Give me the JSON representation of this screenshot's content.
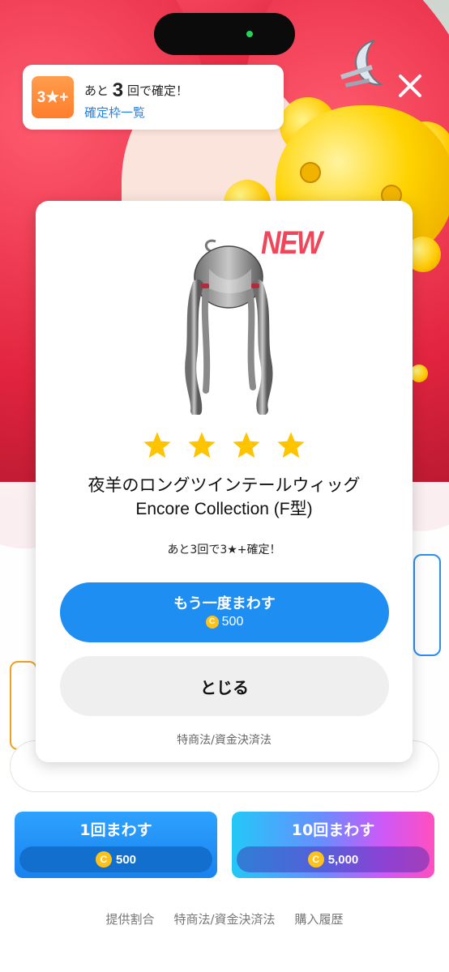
{
  "notice": {
    "badge": "3★+",
    "prefix": "あと",
    "count": "3",
    "suffix": "回で確定！",
    "link": "確定枠一覧"
  },
  "result": {
    "new_badge": "NEW",
    "rarity_stars": 4,
    "item_name_line1": "夜羊のロングツインテールウィッグ",
    "item_name_line2": "Encore Collection (F型)",
    "remaining_text": "あと3回で3★+確定！"
  },
  "actions": {
    "spin_again_label": "もう一度まわす",
    "spin_again_cost": "500",
    "close_label": "とじる",
    "legal_link": "特商法/資金決済法"
  },
  "coin_symbol": "C",
  "gacha": {
    "single_label": "1回まわす",
    "single_cost": "500",
    "ten_label": "10回まわす",
    "ten_cost": "5,000"
  },
  "footer": {
    "rates": "提供割合",
    "legal": "特商法/資金決済法",
    "history": "購入履歴"
  },
  "colors": {
    "primary_blue": "#1f8ef2",
    "new_red": "#f0465a",
    "star_yellow": "#ffc400",
    "notice_orange": "#ff8a36"
  }
}
